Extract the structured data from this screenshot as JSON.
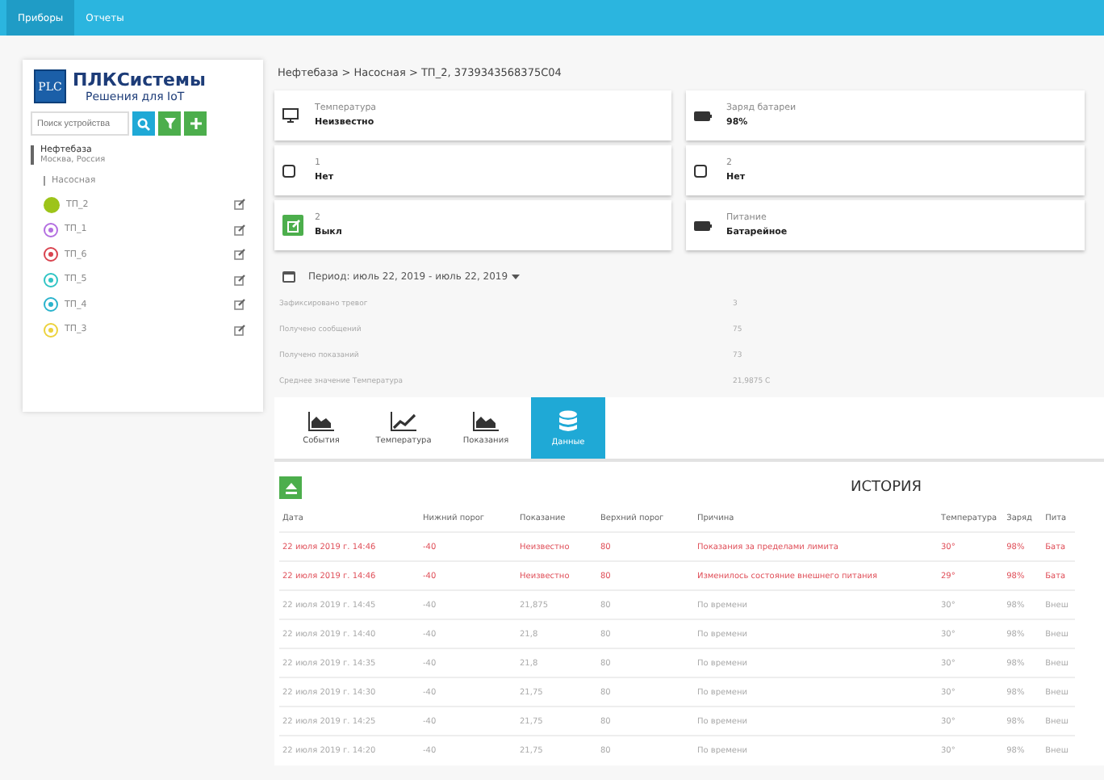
{
  "top_nav": [
    {
      "label": "Приборы",
      "selected": true
    },
    {
      "label": "Отчеты",
      "selected": false
    }
  ],
  "sidebar": {
    "logo": {
      "mark": "PLC",
      "title": "ПЛКСистемы",
      "subtitle": "Решения для IoT"
    },
    "search": {
      "placeholder": "Поиск устройства"
    },
    "tree": [
      {
        "name": "Нефтебаза",
        "location": "Москва, Россия",
        "children": [
          {
            "name": "Насосная",
            "children": [
              {
                "name": "ТП_2",
                "color": "#9dc41a",
                "selected": true
              },
              {
                "name": "ТП_1",
                "color": "#b36ee0",
                "selected": false
              },
              {
                "name": "ТП_6",
                "color": "#d9434f",
                "selected": false
              },
              {
                "name": "ТП_5",
                "color": "#2fc4c4",
                "selected": false
              },
              {
                "name": "ТП_4",
                "color": "#2ab3cc",
                "selected": false
              },
              {
                "name": "ТП_3",
                "color": "#ecd23c",
                "selected": false
              }
            ]
          }
        ]
      }
    ]
  },
  "breadcrumb": "Нефтебаза > Насосная > ТП_2, 3739343568375C04",
  "cards": [
    {
      "kind": "monitor",
      "label": "Температура",
      "value": "Неизвестно"
    },
    {
      "kind": "battery",
      "label": "Заряд батареи",
      "value": "98%"
    },
    {
      "kind": "checkbox",
      "label": "1",
      "value": "Нет",
      "checked": false
    },
    {
      "kind": "checkbox",
      "label": "2",
      "value": "Нет",
      "checked": false
    },
    {
      "kind": "switch",
      "label": "2",
      "value": "Выкл"
    },
    {
      "kind": "battery",
      "label": "Питание",
      "value": "Батарейное"
    }
  ],
  "period": "Период: июль 22, 2019 - июль 22, 2019",
  "stats": [
    {
      "label": "Зафиксировано тревог",
      "value": "3"
    },
    {
      "label": "Получено сообщений",
      "value": "75"
    },
    {
      "label": "Получено показаний",
      "value": "73"
    },
    {
      "label": "Среднее значение Температура",
      "value": "21,9875 C"
    }
  ],
  "view_tabs": [
    {
      "kind": "area",
      "label": "События",
      "selected": false
    },
    {
      "kind": "line",
      "label": "Температура",
      "selected": false
    },
    {
      "kind": "area",
      "label": "Показания",
      "selected": false
    },
    {
      "kind": "database",
      "label": "Данные",
      "selected": true
    }
  ],
  "history": {
    "title": "ИСТОРИЯ",
    "columns": [
      "Дата",
      "Нижний порог",
      "Показание",
      "Верхний порог",
      "Причина",
      "Температура",
      "Заряд",
      "Пита"
    ],
    "rows": [
      {
        "kind": "alert",
        "cells": [
          "22 июля 2019 г. 14:46",
          "-40",
          "Неизвестно",
          "80",
          "Показания за пределами лимита",
          "30°",
          "98%",
          "Бата"
        ]
      },
      {
        "kind": "alert",
        "cells": [
          "22 июля 2019 г. 14:46",
          "-40",
          "Неизвестно",
          "80",
          "Изменилось состояние внешнего питания",
          "29°",
          "98%",
          "Бата"
        ]
      },
      {
        "kind": "normal",
        "cells": [
          "22 июля 2019 г. 14:45",
          "-40",
          "21,875",
          "80",
          "По времени",
          "30°",
          "98%",
          "Внеш"
        ]
      },
      {
        "kind": "normal",
        "cells": [
          "22 июля 2019 г. 14:40",
          "-40",
          "21,8",
          "80",
          "По времени",
          "30°",
          "98%",
          "Внеш"
        ]
      },
      {
        "kind": "normal",
        "cells": [
          "22 июля 2019 г. 14:35",
          "-40",
          "21,8",
          "80",
          "По времени",
          "30°",
          "98%",
          "Внеш"
        ]
      },
      {
        "kind": "normal",
        "cells": [
          "22 июля 2019 г. 14:30",
          "-40",
          "21,75",
          "80",
          "По времени",
          "30°",
          "98%",
          "Внеш"
        ]
      },
      {
        "kind": "normal",
        "cells": [
          "22 июля 2019 г. 14:25",
          "-40",
          "21,75",
          "80",
          "По времени",
          "30°",
          "98%",
          "Внеш"
        ]
      },
      {
        "kind": "normal",
        "cells": [
          "22 июля 2019 г. 14:20",
          "-40",
          "21,75",
          "80",
          "По времени",
          "30°",
          "98%",
          "Внеш"
        ]
      }
    ]
  }
}
